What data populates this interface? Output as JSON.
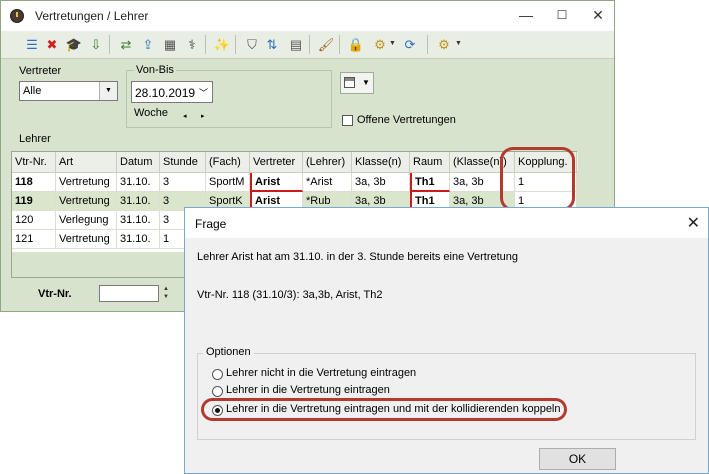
{
  "window": {
    "title": "Vertretungen / Lehrer",
    "controls": {
      "minimize": "—",
      "maximize": "☐",
      "close": "✕"
    }
  },
  "toolbar": [
    {
      "name": "list-icon",
      "glyph": "☰",
      "color": "#2f6fbf"
    },
    {
      "name": "delete-icon",
      "glyph": "✖",
      "color": "#d02020"
    },
    {
      "name": "teacher-hat-icon",
      "glyph": "🎓",
      "color": "#222"
    },
    {
      "name": "import-icon",
      "glyph": "⇩",
      "color": "#3d7a2d"
    },
    {
      "name": "swap-icon",
      "glyph": "⇄",
      "color": "#3d7a2d"
    },
    {
      "name": "export-icon",
      "glyph": "⇪",
      "color": "#2f6fbf"
    },
    {
      "name": "calculator-icon",
      "glyph": "▦",
      "color": "#555"
    },
    {
      "name": "stethoscope-icon",
      "glyph": "⚕",
      "color": "#444"
    },
    {
      "name": "magic-wand-icon",
      "glyph": "✨",
      "color": "#a06020"
    },
    {
      "name": "filter-icon",
      "glyph": "⛉",
      "color": "#555"
    },
    {
      "name": "sort-icon",
      "glyph": "⇅",
      "color": "#2f6fbf"
    },
    {
      "name": "table-icon",
      "glyph": "▤",
      "color": "#555"
    },
    {
      "name": "brush-icon",
      "glyph": "🖌",
      "color": "#a06020"
    },
    {
      "name": "lock-icon",
      "glyph": "🔒",
      "color": "#c09020"
    },
    {
      "name": "settings-page-icon",
      "glyph": "⚙",
      "color": "#c09020"
    },
    {
      "name": "refresh-icon",
      "glyph": "⟳",
      "color": "#2f6fbf"
    },
    {
      "name": "gear-icon",
      "glyph": "⚙",
      "color": "#c09020"
    }
  ],
  "filters": {
    "vertreter_label": "Vertreter",
    "vertreter_value": "Alle",
    "vonbis_label": "Von-Bis",
    "date_value": "28.10.2019",
    "woche_label": "Woche",
    "offene_label": "Offene Vertretungen",
    "lehrer_label": "Lehrer"
  },
  "grid": {
    "columns": [
      "Vtr-Nr.",
      "Art",
      "Datum",
      "Stunde",
      "(Fach)",
      "Vertreter",
      "(Lehrer)",
      "Klasse(n)",
      "Raum",
      "(Klasse(n))",
      "Kopplung."
    ],
    "rows": [
      [
        "118",
        "Vertretung",
        "31.10.",
        "3",
        "SportM",
        "Arist",
        "*Arist",
        "3a, 3b",
        "Th1",
        "3a, 3b",
        "1"
      ],
      [
        "119",
        "Vertretung",
        "31.10.",
        "3",
        "SportK",
        "Arist",
        "*Rub",
        "3a, 3b",
        "Th1",
        "3a, 3b",
        "1"
      ],
      [
        "120",
        "Verlegung",
        "31.10.",
        "3",
        "",
        "",
        "",
        "",
        "",
        "",
        ""
      ],
      [
        "121",
        "Vertretung",
        "31.10.",
        "1",
        "",
        "",
        "",
        "",
        "",
        "",
        ""
      ]
    ]
  },
  "footer": {
    "vtr_label": "Vtr-Nr.",
    "vtr_value": ""
  },
  "dialog": {
    "title": "Frage",
    "close": "✕",
    "message": "Lehrer Arist hat am 31.10. in der 3. Stunde bereits eine Vertretung",
    "detail": "Vtr-Nr. 118 (31.10/3): 3a,3b, Arist, Th2",
    "group_label": "Optionen",
    "options": [
      "Lehrer nicht in die Vertretung eintragen",
      "Lehrer in die Vertretung eintragen",
      "Lehrer in die Vertretung eintragen und mit der kollidierenden koppeln"
    ],
    "selected_option": 2,
    "ok_label": "OK"
  },
  "colors": {
    "window_bg": "#d7e3cd",
    "highlight": "#b43a2e",
    "conflict": "#d01818",
    "selected_row": "#d9e6cc"
  }
}
